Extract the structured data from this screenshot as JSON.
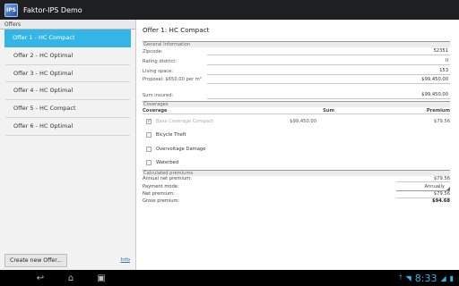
{
  "app": {
    "title": "Faktor-IPS Demo",
    "icon_label": "IPS"
  },
  "offers": {
    "header": "Offers",
    "items": [
      {
        "label": "Offer 1 - HC Compact"
      },
      {
        "label": "Offer 2 - HC Optimal"
      },
      {
        "label": "Offer 3 - HC Optimal"
      },
      {
        "label": "Offer 4 - HC Optimal"
      },
      {
        "label": "Offer 5 - HC Compact"
      },
      {
        "label": "Offer 6 - HC Optimal"
      }
    ],
    "create_label": "Create new Offer...",
    "info_label": "Info"
  },
  "detail": {
    "title": "Offer 1: HC Compact",
    "general": {
      "header": "General Information",
      "zipcode_label": "Zipcode:",
      "zipcode": "52351",
      "rating_label": "Rating district:",
      "rating": "II",
      "living_label": "Living space:",
      "living": "153",
      "proposal_label": "Proposal: $650.00 per m²",
      "proposal": "$99,450.00",
      "sum_label": "Sum insured:",
      "sum": "$99,450.00"
    },
    "coverages": {
      "header": "Coverages",
      "col_coverage": "Coverage",
      "col_sum": "Sum",
      "col_premium": "Premium",
      "rows": [
        {
          "name": "Base Coverage Compact",
          "sum": "$99,450.00",
          "premium": "$79.56"
        },
        {
          "name": "Bicycle Theft",
          "sum": "",
          "premium": ""
        },
        {
          "name": "Overvoltage Damage",
          "sum": "",
          "premium": ""
        },
        {
          "name": "Waterbed",
          "sum": "",
          "premium": ""
        }
      ]
    },
    "calculated": {
      "header": "Calculated premiums",
      "annual_label": "Annual net premium:",
      "annual": "$79.56",
      "payment_label": "Payment mode:",
      "payment": "Annually",
      "net_label": "Net premium:",
      "net": "$79.56",
      "gross_label": "Gross premium:",
      "gross": "$94.68"
    }
  },
  "system": {
    "time": "8:33",
    "accent": "#33b5e5"
  }
}
